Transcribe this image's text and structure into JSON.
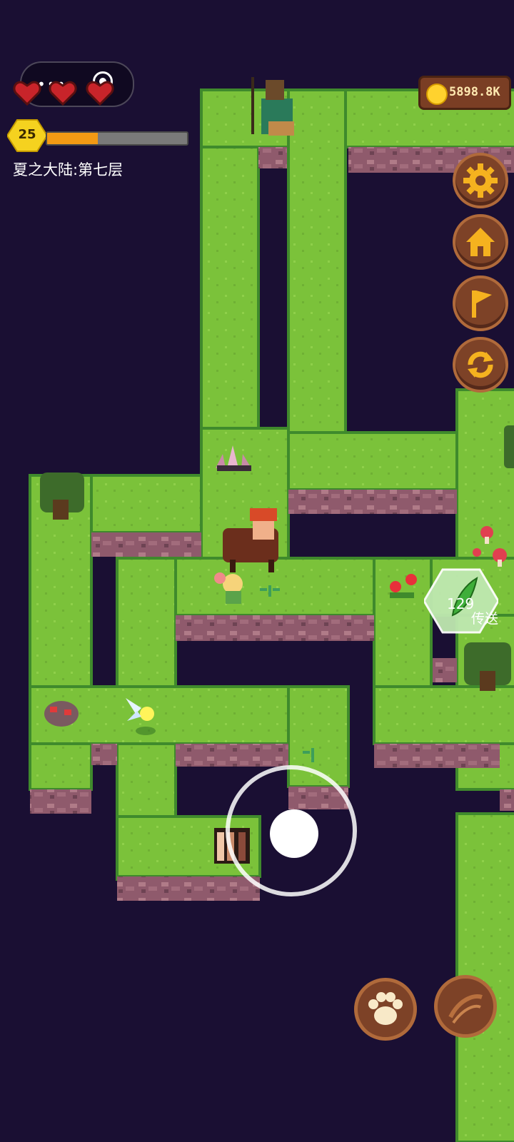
{
  "hud": {
    "hearts": 3,
    "level": "25",
    "xp_fraction": 0.36,
    "floor_label": "夏之大陆:第七层",
    "coins": "5898.8K"
  },
  "menu_buttons": [
    {
      "id": "settings",
      "icon": "gear-icon"
    },
    {
      "id": "home",
      "icon": "house-icon"
    },
    {
      "id": "flag",
      "icon": "flag-icon"
    },
    {
      "id": "refresh",
      "icon": "refresh-icon"
    }
  ],
  "teleport": {
    "count": "129",
    "label": "传送"
  },
  "action_buttons": [
    {
      "id": "pet",
      "icon": "paw-icon"
    },
    {
      "id": "attack",
      "icon": "slash-icon"
    }
  ],
  "colors": {
    "background": "#1a0f33",
    "grass": "#7bc23a",
    "grass_edge": "#3f8a2c",
    "cliff": "#a0697a",
    "button_wood": "#7d4227",
    "accent_gold": "#f5b21f"
  }
}
